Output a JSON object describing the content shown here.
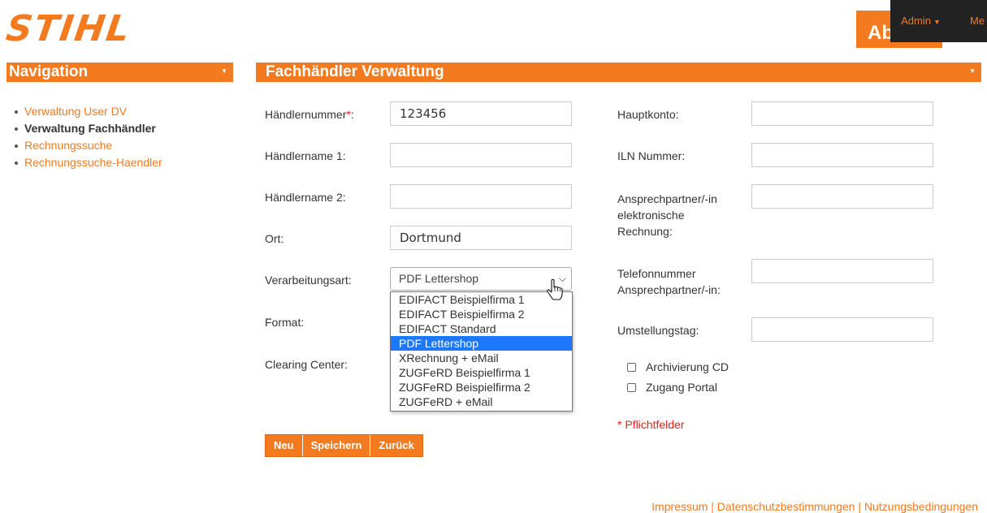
{
  "brand": {
    "logo_text": "STIHL"
  },
  "topbar": {
    "button_label": "Ab",
    "admin_label": "Admin",
    "menu_partial": "Me"
  },
  "nav": {
    "title": "Navigation",
    "items": [
      {
        "label": "Verwaltung User DV",
        "active": false
      },
      {
        "label": "Verwaltung Fachhändler",
        "active": true
      },
      {
        "label": "Rechnungssuche",
        "active": false
      },
      {
        "label": "Rechnungssuche-Haendler",
        "active": false
      }
    ]
  },
  "main": {
    "title": "Fachhändler Verwaltung"
  },
  "form": {
    "haendlernummer_label": "Händlernummer",
    "required_mark": "*",
    "colon": ":",
    "haendlernummer_value": "123456",
    "haendlername1_label": "Händlername 1:",
    "haendlername1_value": "",
    "haendlername2_label": "Händlername 2:",
    "haendlername2_value": "",
    "ort_label": "Ort:",
    "ort_value": "Dortmund",
    "verarbeitungsart_label": "Verarbeitungsart:",
    "verarbeitungsart_value": "PDF Lettershop",
    "verarbeitungsart_options": [
      "EDIFACT Beispielfirma 1",
      "EDIFACT Beispielfirma 2",
      "EDIFACT Standard",
      "PDF Lettershop",
      "XRechnung + eMail",
      "ZUGFeRD Beispielfirma 1",
      "ZUGFeRD Beispielfirma 2",
      "ZUGFeRD + eMail"
    ],
    "format_label": "Format:",
    "clearing_label": "Clearing Center:",
    "hauptkonto_label": "Hauptkonto:",
    "hauptkonto_value": "",
    "iln_label": "ILN Nummer:",
    "iln_value": "",
    "ansprech_line1": "Ansprechpartner/-in",
    "ansprech_line2": "elektronische",
    "ansprech_line3": "Rechnung:",
    "ansprech_value": "",
    "telefon_line1": "Telefonnummer",
    "telefon_line2": "Ansprechpartner/-in:",
    "telefon_value": "",
    "umstellungstag_label": "Umstellungstag:",
    "umstellungstag_value": "",
    "archivierung_label": "Archivierung CD",
    "archivierung_checked": false,
    "zugang_label": "Zugang Portal",
    "zugang_checked": false,
    "pflicht_text": "* Pflichtfelder"
  },
  "buttons": {
    "neu": "Neu",
    "speichern": "Speichern",
    "zurueck": "Zurück"
  },
  "footer": {
    "text": "Impressum |  Datenschutzbestimmungen |  Nutzungsbedingungen"
  },
  "colors": {
    "accent": "#f37a1f",
    "required": "#e02020",
    "highlight": "#1e78ff"
  }
}
